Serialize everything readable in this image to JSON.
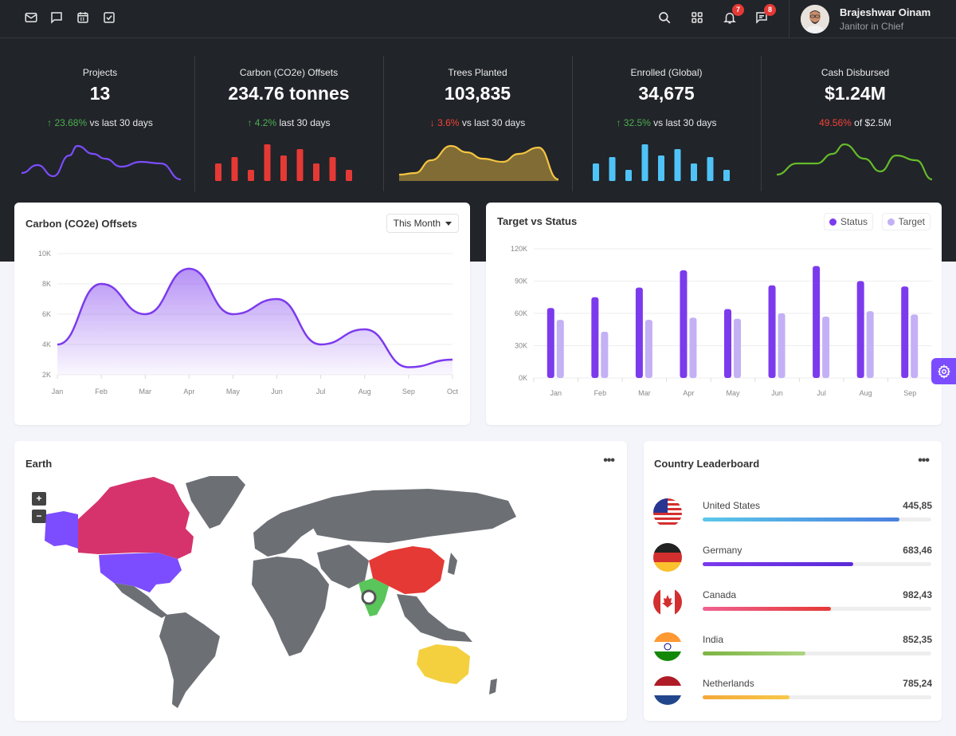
{
  "topbar": {
    "icons": [
      "mail-icon",
      "chat-icon",
      "calendar-icon",
      "checkbox-icon"
    ],
    "right_icons": [
      "search-icon",
      "apps-grid-icon",
      "bell-icon",
      "message-icon"
    ],
    "notifications_count": "7",
    "messages_count": "8",
    "user": {
      "name": "Brajeshwar Oinam",
      "role": "Janitor in Chief"
    }
  },
  "stats": [
    {
      "label": "Projects",
      "value": "13",
      "arrow": "↑",
      "pct": "23.68%",
      "suffix": "vs last 30 days",
      "trend": "up",
      "spark": "line",
      "color": "#7c4dff"
    },
    {
      "label": "Carbon (CO2e) Offsets",
      "value": "234.76 tonnes",
      "arrow": "↑",
      "pct": "4.2%",
      "suffix": "last 30 days",
      "trend": "up",
      "spark": "bar",
      "color": "#e53935"
    },
    {
      "label": "Trees Planted",
      "value": "103,835",
      "arrow": "↓",
      "pct": "3.6%",
      "suffix": "vs last 30 days",
      "trend": "down",
      "spark": "area",
      "color": "#f4c542"
    },
    {
      "label": "Enrolled (Global)",
      "value": "34,675",
      "arrow": "↑",
      "pct": "32.5%",
      "suffix": "vs last 30 days",
      "trend": "up",
      "spark": "bar",
      "color": "#4fc3f7"
    },
    {
      "label": "Cash Disbursed",
      "value": "$1.24M",
      "arrow": "",
      "pct": "49.56%",
      "suffix": "of $2.5M",
      "trend": "down",
      "spark": "line",
      "color": "#66bb2a"
    }
  ],
  "carbon_panel": {
    "title": "Carbon (CO2e) Offsets",
    "dropdown": "This Month"
  },
  "target_panel": {
    "title": "Target vs Status",
    "legend_status": "Status",
    "legend_target": "Target"
  },
  "chart_data": [
    {
      "type": "area",
      "title": "Carbon (CO2e) Offsets",
      "categories": [
        "Jan",
        "Feb",
        "Mar",
        "Apr",
        "May",
        "Jun",
        "Jul",
        "Aug",
        "Sep",
        "Oct"
      ],
      "values": [
        4000,
        8000,
        6000,
        9000,
        6000,
        7000,
        4000,
        5000,
        2500,
        3000
      ],
      "yticks": [
        "10K",
        "8K",
        "6K",
        "4K",
        "2K"
      ],
      "ylim": [
        2000,
        10000
      ],
      "color": "#7c3aed"
    },
    {
      "type": "bar",
      "title": "Target vs Status",
      "categories": [
        "Jan",
        "Feb",
        "Mar",
        "Apr",
        "May",
        "Jun",
        "Jul",
        "Aug",
        "Sep"
      ],
      "series": [
        {
          "name": "Status",
          "values": [
            65000,
            75000,
            84000,
            100000,
            64000,
            86000,
            104000,
            90000,
            85000
          ],
          "color": "#7c3aed"
        },
        {
          "name": "Target",
          "values": [
            54000,
            43000,
            54000,
            56000,
            55000,
            60000,
            57000,
            62000,
            59000
          ],
          "color": "#c4b0f5"
        }
      ],
      "yticks": [
        "120K",
        "90K",
        "60K",
        "30K",
        "0K"
      ],
      "ylim": [
        0,
        120000
      ]
    }
  ],
  "earth_panel": {
    "title": "Earth",
    "zoom_in": "+",
    "zoom_out": "−"
  },
  "leaderboard": {
    "title": "Country Leaderboard",
    "rows": [
      {
        "name": "United States",
        "value": "445,85",
        "progress": 0.86,
        "flag": "us-flag-icon",
        "c1": "#5bc8e8",
        "c2": "#4a7fe0"
      },
      {
        "name": "Germany",
        "value": "683,46",
        "progress": 0.66,
        "flag": "germany-flag-icon",
        "c1": "#7c3aed",
        "c2": "#5a2bd6"
      },
      {
        "name": "Canada",
        "value": "982,43",
        "progress": 0.56,
        "flag": "canada-flag-icon",
        "c1": "#f06292",
        "c2": "#e53935"
      },
      {
        "name": "India",
        "value": "852,35",
        "progress": 0.45,
        "flag": "india-flag-icon",
        "c1": "#7cb342",
        "c2": "#aed581"
      },
      {
        "name": "Netherlands",
        "value": "785,24",
        "progress": 0.38,
        "flag": "netherlands-flag-icon",
        "c1": "#f4a83a",
        "c2": "#f7c94a"
      }
    ]
  }
}
